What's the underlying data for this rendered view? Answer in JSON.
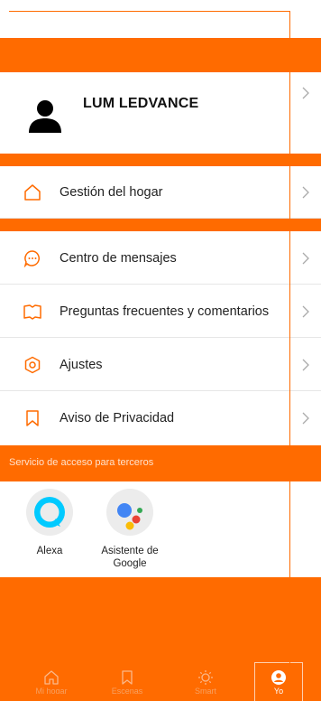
{
  "profile": {
    "name": "LUM LEDVANCE"
  },
  "menu": [
    {
      "label": "Gestión del hogar",
      "icon": "home-icon"
    },
    {
      "label": "Centro de mensajes",
      "icon": "message-bubble-icon"
    },
    {
      "label": "Preguntas frecuentes y comentarios",
      "icon": "book-icon"
    },
    {
      "label": "Ajustes",
      "icon": "settings-hexagon-icon"
    },
    {
      "label": "Aviso de Privacidad",
      "icon": "bookmark-icon"
    }
  ],
  "third_party": {
    "title": "Servicio de acceso para terceros",
    "services": [
      {
        "label": "Alexa",
        "icon": "alexa-icon"
      },
      {
        "label": "Asistente de Google",
        "icon": "google-assistant-icon"
      }
    ]
  },
  "bottom_nav": [
    {
      "label": "Mi hogar",
      "icon": "home-outline-icon"
    },
    {
      "label": "Escenas",
      "icon": "scene-icon"
    },
    {
      "label": "Smart",
      "icon": "sun-icon"
    },
    {
      "label": "Yo",
      "icon": "user-circle-icon",
      "active": true
    }
  ],
  "colors": {
    "accent": "#FF6B00",
    "text": "#222222",
    "divider": "#e6e6e6"
  }
}
